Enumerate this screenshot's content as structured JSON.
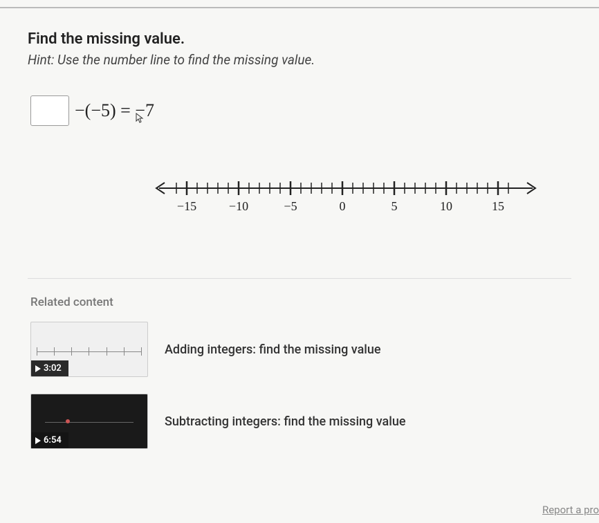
{
  "question": {
    "title": "Find the missing value.",
    "hint": "Hint: Use the number line to find the missing value.",
    "equation_after_box": "−(−5) = −7",
    "answer_value": ""
  },
  "number_line": {
    "ticks": [
      "−15",
      "−10",
      "−5",
      "0",
      "5",
      "10",
      "15"
    ]
  },
  "related": {
    "heading": "Related content",
    "items": [
      {
        "title": "Adding integers: find the missing value",
        "duration": "3:02"
      },
      {
        "title": "Subtracting integers: find the missing value",
        "duration": "6:54"
      }
    ]
  },
  "footer": {
    "report": "Report a pro"
  }
}
